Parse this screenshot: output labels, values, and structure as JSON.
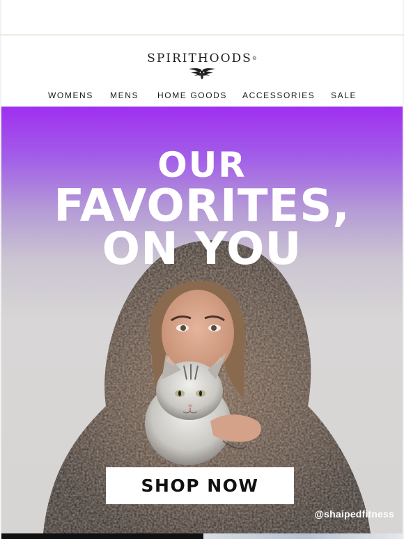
{
  "brand": {
    "logo_text": "SPIRITHOODS",
    "registered_mark": "®"
  },
  "nav": {
    "items": [
      {
        "label": "WOMENS"
      },
      {
        "label": "MENS"
      },
      {
        "label": "HOME GOODS"
      },
      {
        "label": "ACCESSORIES"
      },
      {
        "label": "SALE"
      }
    ]
  },
  "hero": {
    "headline_line1": "OUR",
    "headline_line2": "FAVORITES,",
    "headline_line3": "ON YOU",
    "cta_label": "SHOP NOW",
    "photo_credit": "@shaipedfitness"
  },
  "colors": {
    "accent_purple": "#a02ff0",
    "text_dark": "#1a1a1a",
    "cta_background": "#ffffff"
  }
}
